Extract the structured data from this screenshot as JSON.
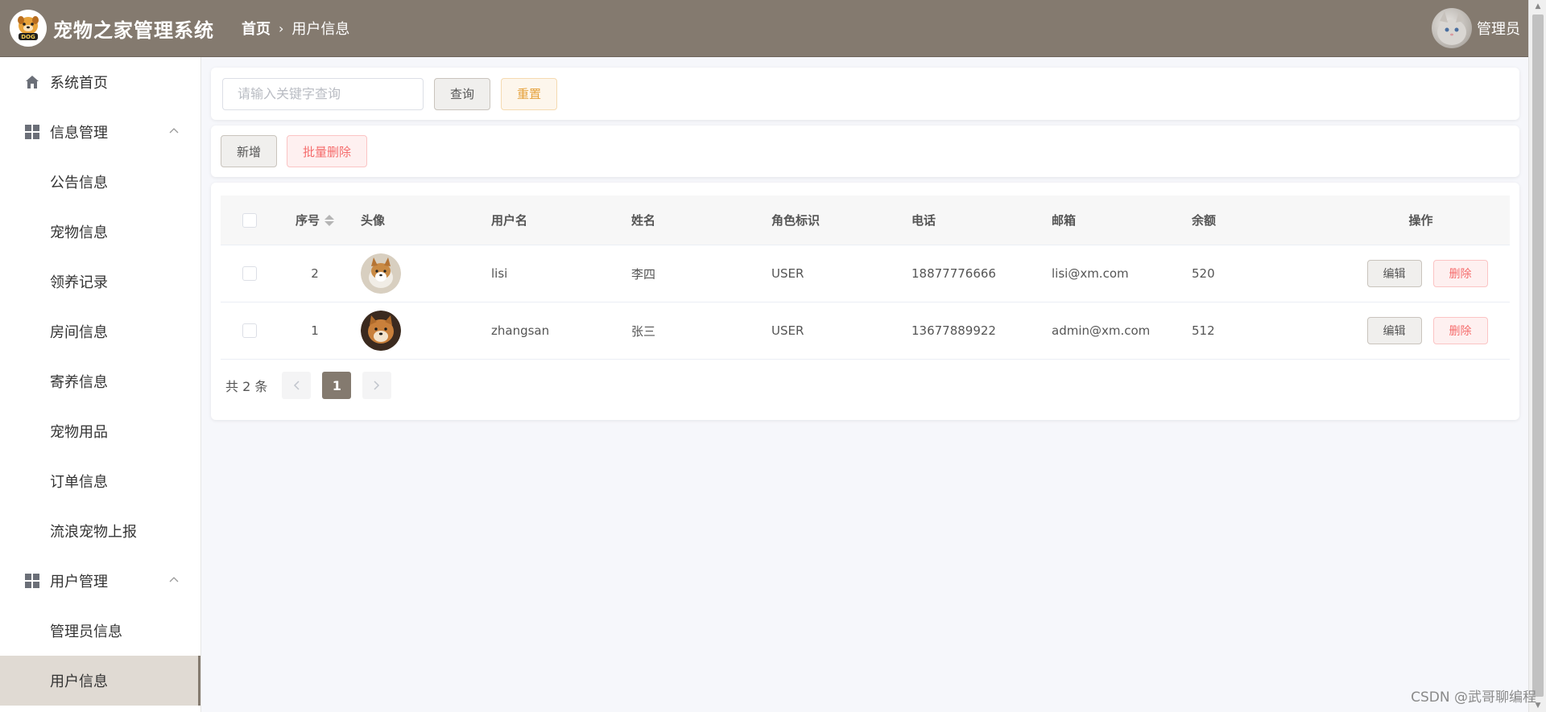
{
  "header": {
    "app_title": "宠物之家管理系统",
    "logo_text": "DOG",
    "breadcrumb": {
      "home": "首页",
      "separator": "›",
      "current": "用户信息"
    },
    "user": {
      "name": "管理员"
    }
  },
  "sidebar": {
    "home": {
      "label": "系统首页",
      "icon": "home-icon"
    },
    "groups": [
      {
        "label": "信息管理",
        "icon": "grid-icon",
        "expanded": true,
        "items": [
          "公告信息",
          "宠物信息",
          "领养记录",
          "房间信息",
          "寄养信息",
          "宠物用品",
          "订单信息",
          "流浪宠物上报"
        ]
      },
      {
        "label": "用户管理",
        "icon": "grid-icon",
        "expanded": true,
        "items": [
          "管理员信息",
          "用户信息"
        ]
      }
    ],
    "active_item": "用户信息"
  },
  "search": {
    "placeholder": "请输入关键字查询",
    "value": "",
    "query_label": "查询",
    "reset_label": "重置"
  },
  "actions": {
    "add_label": "新增",
    "batch_delete_label": "批量删除"
  },
  "table": {
    "columns": [
      "序号",
      "头像",
      "用户名",
      "姓名",
      "角色标识",
      "电话",
      "邮箱",
      "余额",
      "操作"
    ],
    "rows": [
      {
        "id": "2",
        "avatar": "corgi-avatar",
        "username": "lisi",
        "name": "李四",
        "role": "USER",
        "phone": "18877776666",
        "email": "lisi@xm.com",
        "balance": "520"
      },
      {
        "id": "1",
        "avatar": "shiba-avatar",
        "username": "zhangsan",
        "name": "张三",
        "role": "USER",
        "phone": "13677889922",
        "email": "admin@xm.com",
        "balance": "512"
      }
    ],
    "edit_label": "编辑",
    "delete_label": "删除"
  },
  "pagination": {
    "total_text": "共 2 条",
    "current_page": "1",
    "prev_icon": "chevron-left-icon",
    "next_icon": "chevron-right-icon"
  },
  "watermark": "CSDN @武哥聊编程",
  "colors": {
    "header_bg": "#847a6f",
    "active_menu_bg": "#e0dad3",
    "danger": "#f56c6c",
    "warning": "#e6a23c"
  }
}
